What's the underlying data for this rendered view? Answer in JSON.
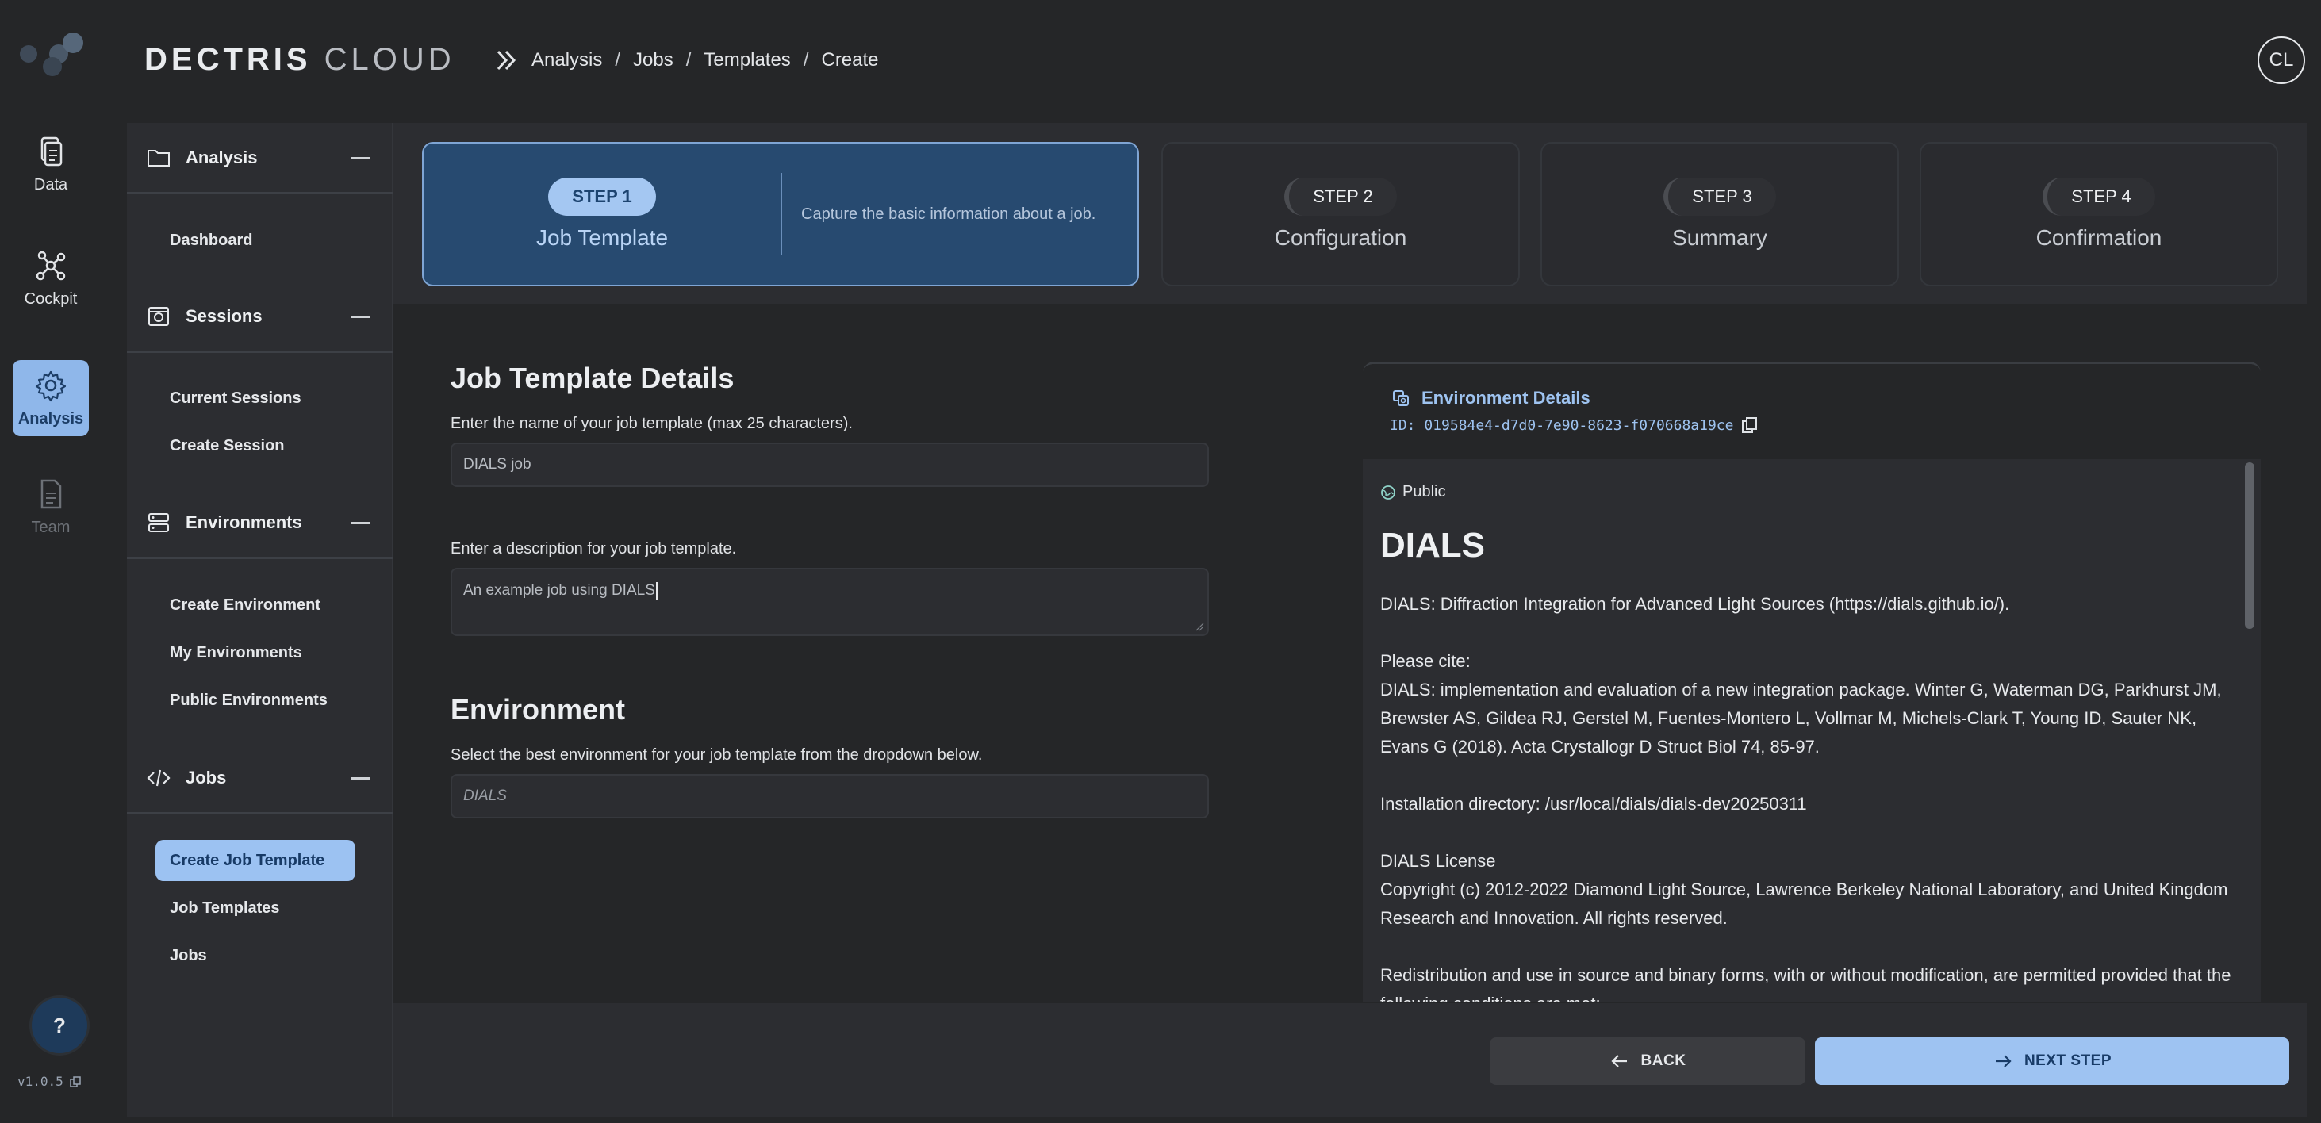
{
  "app": {
    "brand_bold": "DECTRIS",
    "brand_light": "CLOUD",
    "avatar_initials": "CL",
    "version": "v1.0.5",
    "accent": "#9ec3f2"
  },
  "breadcrumb": [
    "Analysis",
    "/",
    "Jobs",
    "/",
    "Templates",
    "/",
    "Create"
  ],
  "rail": {
    "items": [
      {
        "label": "Data",
        "icon": "document-icon"
      },
      {
        "label": "Cockpit",
        "icon": "network-icon"
      },
      {
        "label": "Analysis",
        "icon": "gear-icon"
      },
      {
        "label": "Team",
        "icon": "document-icon"
      }
    ],
    "help_label": "?"
  },
  "sidebar": {
    "sections": [
      {
        "label": "Analysis",
        "icon": "folder-icon",
        "items": [
          "Dashboard"
        ]
      },
      {
        "label": "Sessions",
        "icon": "session-icon",
        "items": [
          "Current Sessions",
          "Create Session"
        ]
      },
      {
        "label": "Environments",
        "icon": "server-icon",
        "items": [
          "Create Environment",
          "My Environments",
          "Public Environments"
        ]
      },
      {
        "label": "Jobs",
        "icon": "code-icon",
        "items": [
          "Create Job Template",
          "Job Templates",
          "Jobs"
        ]
      }
    ],
    "active_item": "Create Job Template"
  },
  "stepper": {
    "steps": [
      {
        "badge": "STEP 1",
        "title": "Job Template",
        "description": "Capture the basic information about a job."
      },
      {
        "badge": "STEP 2",
        "title": "Configuration"
      },
      {
        "badge": "STEP 3",
        "title": "Summary"
      },
      {
        "badge": "STEP 4",
        "title": "Confirmation"
      }
    ],
    "active_step": 1
  },
  "form": {
    "details_heading": "Job Template Details",
    "name_hint": "Enter the name of your job template (max 25 characters).",
    "name_value": "DIALS job",
    "desc_hint": "Enter a description for your job template.",
    "desc_value": "An example job using DIALS",
    "env_heading": "Environment",
    "env_hint": "Select the best environment for your job template from the dropdown below.",
    "env_value": "DIALS"
  },
  "environment": {
    "title": "Environment Details",
    "id": "ID: 019584e4-d7d0-7e90-8623-f070668a19ce",
    "visibility": "Public",
    "name": "DIALS",
    "paragraphs": [
      "DIALS: Diffraction Integration for Advanced Light Sources (https://dials.github.io/).",
      "Please cite:\nDIALS: implementation and evaluation of a new integration package. Winter G, Waterman DG, Parkhurst JM, Brewster AS, Gildea RJ, Gerstel M, Fuentes-Montero L, Vollmar M, Michels-Clark T, Young ID, Sauter NK, Evans G (2018). Acta Crystallogr D Struct Biol 74, 85-97.",
      "Installation directory: /usr/local/dials/dials-dev20250311",
      "DIALS License\nCopyright (c) 2012-2022 Diamond Light Source, Lawrence Berkeley National Laboratory, and United Kingdom Research and Innovation. All rights reserved.",
      "Redistribution and use in source and binary forms, with or without modification, are permitted provided that the following conditions are met:"
    ]
  },
  "footer": {
    "back_label": "BACK",
    "next_label": "NEXT STEP"
  }
}
